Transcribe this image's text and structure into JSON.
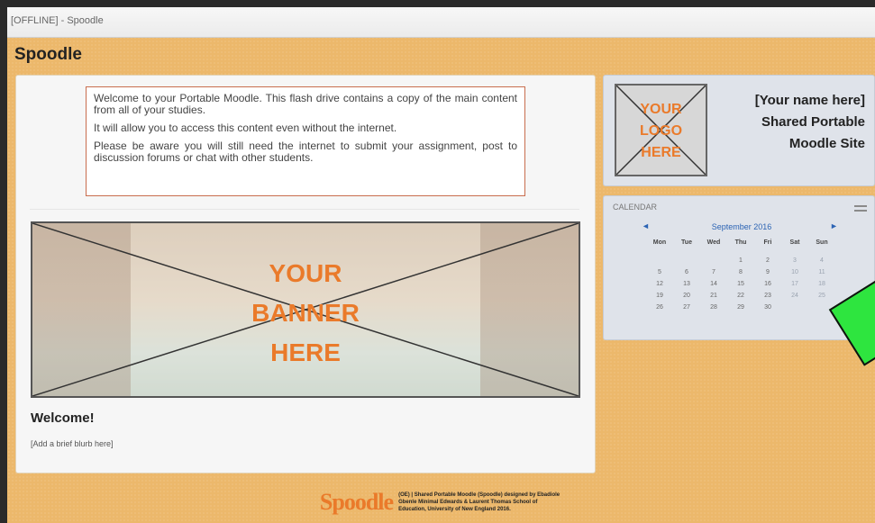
{
  "window": {
    "title": "[OFFLINE] - Spoodle"
  },
  "site": {
    "title": "Spoodle"
  },
  "welcome_box": {
    "paragraphs": [
      "Welcome to your Portable Moodle. This flash drive contains a copy of the main content from all of your studies.",
      "It will allow you to access this content even without the internet.",
      "Please be aware you will still need the internet to submit your assignment, post to discussion forums or chat with other students."
    ]
  },
  "banner": {
    "lines": [
      "YOUR",
      "BANNER",
      "HERE"
    ]
  },
  "main": {
    "welcome_heading": "Welcome!",
    "blurb": "[Add a brief blurb here]"
  },
  "logo": {
    "lines": [
      "YOUR",
      "LOGO",
      "HERE"
    ]
  },
  "site_info": {
    "lines": [
      "[Your name here]",
      "Shared Portable",
      "Moodle Site"
    ]
  },
  "calendar": {
    "header": "CALENDAR",
    "prev": "◄",
    "next": "►",
    "month": "September 2016",
    "day_headers": [
      "Mon",
      "Tue",
      "Wed",
      "Thu",
      "Fri",
      "Sat",
      "Sun"
    ],
    "weeks": [
      [
        "",
        "",
        "",
        "1",
        "2",
        "3",
        "4"
      ],
      [
        "5",
        "6",
        "7",
        "8",
        "9",
        "10",
        "11"
      ],
      [
        "12",
        "13",
        "14",
        "15",
        "16",
        "17",
        "18"
      ],
      [
        "19",
        "20",
        "21",
        "22",
        "23",
        "24",
        "25"
      ],
      [
        "26",
        "27",
        "28",
        "29",
        "30",
        "",
        ""
      ]
    ]
  },
  "footer": {
    "logo": "Spoodle",
    "credit": "(OE) | Shared Portable Moodle (Spoodle) designed by Ebadiole Gbenle Minimal Edwards & Laurent Thomas School of Education, University of New England 2016."
  },
  "colors": {
    "page_background": "#ecb86b",
    "accent_orange": "#ea7a2a",
    "panel_blue_grey": "#dfe3ea",
    "link_blue": "#2c64b4",
    "welcome_border": "#c86d4e"
  }
}
